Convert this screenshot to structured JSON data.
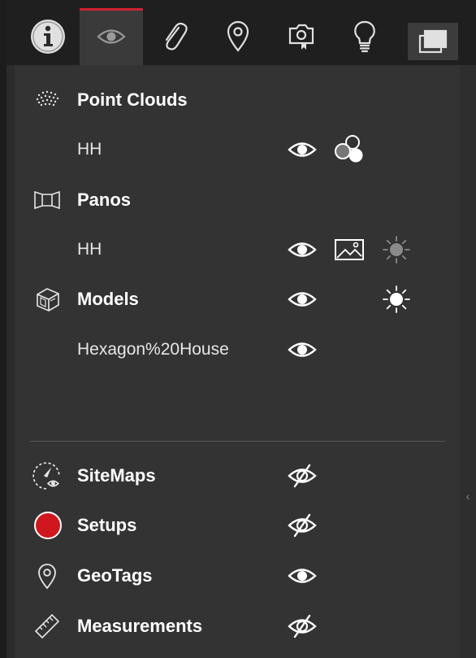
{
  "accent_color": "#d0202f",
  "toolbar": {
    "tabs": [
      {
        "icon": "info-icon"
      },
      {
        "icon": "eye-icon",
        "active": true
      },
      {
        "icon": "paperclip-icon"
      },
      {
        "icon": "location-pin-icon"
      },
      {
        "icon": "camera-bookmark-icon"
      },
      {
        "icon": "lightbulb-icon"
      },
      {
        "icon": "window-overlay-icon"
      }
    ]
  },
  "layers": {
    "point_clouds": {
      "label": "Point Clouds",
      "icon": "point-cloud-icon",
      "items": [
        {
          "label": "HH"
        }
      ]
    },
    "panos": {
      "label": "Panos",
      "icon": "panorama-icon",
      "items": [
        {
          "label": "HH"
        }
      ]
    },
    "models": {
      "label": "Models",
      "icon": "model-cube-icon",
      "items": [
        {
          "label": "Hexagon%20House"
        }
      ]
    },
    "sitemaps": {
      "label": "SiteMaps",
      "icon": "sitemap-compass-icon",
      "visible": false
    },
    "setups": {
      "label": "Setups",
      "icon": "setup-dot-icon",
      "color": "#d0171f",
      "visible": false
    },
    "geotags": {
      "label": "GeoTags",
      "icon": "geotag-pin-icon",
      "visible": true
    },
    "measurements": {
      "label": "Measurements",
      "icon": "ruler-icon",
      "visible": false
    }
  }
}
